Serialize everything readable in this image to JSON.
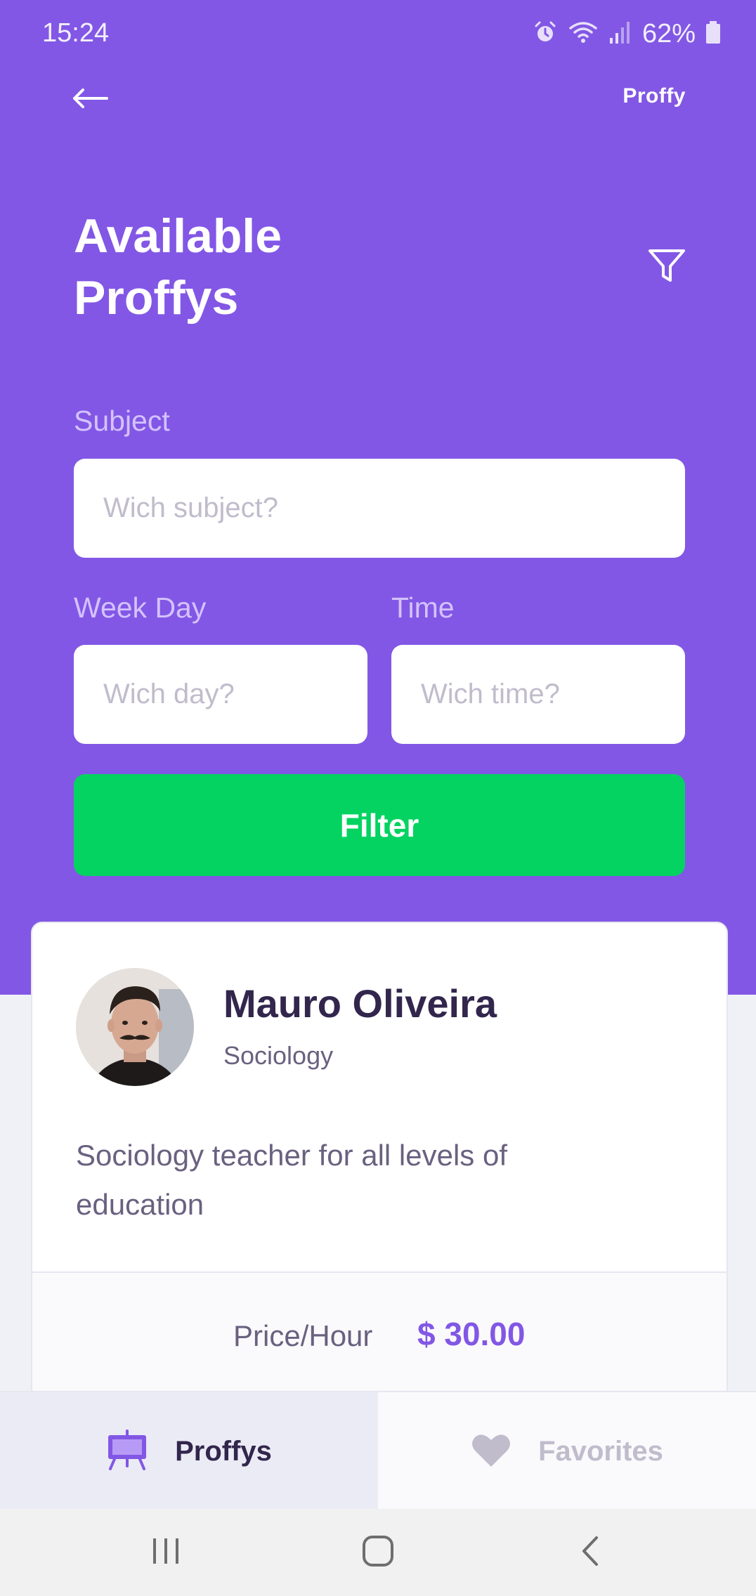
{
  "status_bar": {
    "time": "15:24",
    "battery": "62%",
    "icons": [
      "alarm-icon",
      "wifi-icon",
      "signal-icon",
      "battery-icon"
    ]
  },
  "header": {
    "brand": "Proffy",
    "back_icon": "arrow-left-icon",
    "title_line1": "Available",
    "title_line2": "Proffys",
    "filter_icon": "filter-funnel-icon"
  },
  "form": {
    "subject": {
      "label": "Subject",
      "placeholder": "Wich subject?",
      "value": ""
    },
    "week_day": {
      "label": "Week Day",
      "placeholder": "Wich day?",
      "value": ""
    },
    "time": {
      "label": "Time",
      "placeholder": "Wich time?",
      "value": ""
    },
    "submit_label": "Filter"
  },
  "teachers": [
    {
      "name": "Mauro Oliveira",
      "subject": "Sociology",
      "bio": "Sociology teacher for all levels of education",
      "price_label": "Price/Hour",
      "price": "$ 30.00"
    }
  ],
  "tabs": [
    {
      "label": "Proffys",
      "icon": "easel-icon",
      "active": true
    },
    {
      "label": "Favorites",
      "icon": "heart-icon",
      "active": false
    }
  ],
  "nav_bar": {
    "buttons": [
      "recent-apps-icon",
      "home-icon",
      "back-icon"
    ]
  },
  "colors": {
    "primary": "#8257E5",
    "secondary": "#04D361",
    "label": "#D4C2FF",
    "text_title": "#32264D",
    "text_base": "#6A6180",
    "placeholder": "#C1BCCC",
    "background": "#F0F0F7"
  }
}
